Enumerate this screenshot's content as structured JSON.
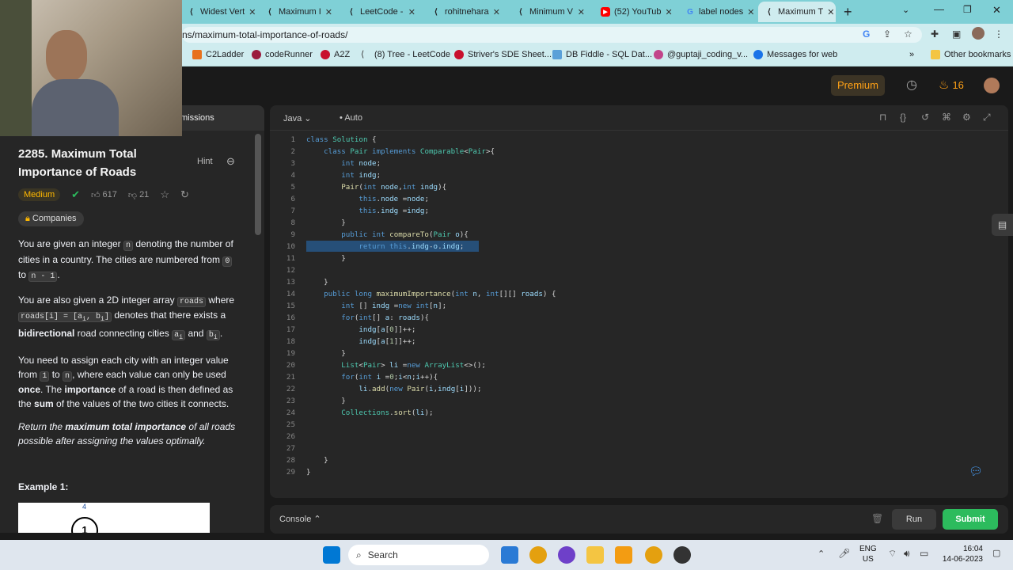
{
  "browser": {
    "tabs": [
      {
        "label": "Widest Vert",
        "icon": "code-tab-icon"
      },
      {
        "label": "Maximum I",
        "icon": "code-tab-icon"
      },
      {
        "label": "LeetCode -",
        "icon": "code-tab-icon"
      },
      {
        "label": "rohitnehara",
        "icon": "code-tab-icon"
      },
      {
        "label": "Minimum V",
        "icon": "code-tab-icon"
      },
      {
        "label": "(52) YouTub",
        "icon": "youtube-icon"
      },
      {
        "label": "label nodes",
        "icon": "google-icon"
      },
      {
        "label": "Maximum T",
        "icon": "code-tab-icon",
        "active": true
      }
    ],
    "url": "ns/maximum-total-importance-of-roads/",
    "bookmarks": [
      {
        "label": "C2Ladder"
      },
      {
        "label": "codeRunner"
      },
      {
        "label": "A2Z"
      },
      {
        "label": "(8) Tree - LeetCode"
      },
      {
        "label": "Striver's SDE Sheet..."
      },
      {
        "label": "DB Fiddle - SQL Dat..."
      },
      {
        "label": "@guptaji_coding_v..."
      },
      {
        "label": "Messages for web"
      }
    ],
    "bookmarks_more": "»",
    "other_bookmarks": "Other bookmarks"
  },
  "nav": {
    "premium": "Premium",
    "streak": "16"
  },
  "left_tabs": {
    "submissions": "missions"
  },
  "problem": {
    "title": "2285. Maximum Total Importance of Roads",
    "difficulty": "Medium",
    "hint": "Hint",
    "likes": "617",
    "dislikes": "21",
    "companies": "Companies",
    "example_heading": "Example 1:",
    "example_node": "1",
    "example_node_label": "4"
  },
  "editor": {
    "language": "Java",
    "mode": "Auto",
    "highlight_color": "#264f78",
    "lines": [
      "1",
      "2",
      "3",
      "4",
      "5",
      "6",
      "7",
      "8",
      "9",
      "10",
      "11",
      "12",
      "13",
      "14",
      "15",
      "16",
      "17",
      "18",
      "19",
      "20",
      "21",
      "22",
      "23",
      "24",
      "25",
      "26",
      "27",
      "28",
      "29"
    ]
  },
  "console": {
    "label": "Console",
    "run": "Run",
    "submit": "Submit"
  },
  "taskbar": {
    "search": "Search",
    "lang1": "ENG",
    "lang2": "US",
    "time": "16:04",
    "date": "14-06-2023"
  },
  "colors": {
    "accent": "#ffa116",
    "medium": "#ffb800",
    "submit": "#2cbb5d"
  }
}
